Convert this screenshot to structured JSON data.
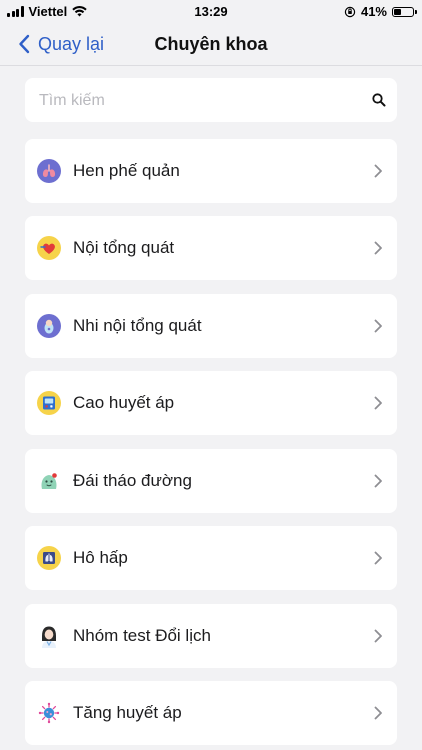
{
  "status_bar": {
    "carrier": "Viettel",
    "time": "13:29",
    "battery": "41%",
    "battery_level": 0.41
  },
  "nav": {
    "back_label": "Quay lại",
    "title": "Chuyên khoa"
  },
  "search": {
    "placeholder": "Tìm kiếm",
    "value": ""
  },
  "specialties": [
    {
      "label": "Hen phế quản",
      "icon": "lungs-icon"
    },
    {
      "label": "Nội tổng quát",
      "icon": "heart-icon"
    },
    {
      "label": "Nhi nội tổng quát",
      "icon": "baby-icon"
    },
    {
      "label": "Cao huyết áp",
      "icon": "blood-pressure-icon"
    },
    {
      "label": "Đái tháo đường",
      "icon": "diabetes-icon"
    },
    {
      "label": "Hô hấp",
      "icon": "xray-icon"
    },
    {
      "label": "Nhóm test Đổi lịch",
      "icon": "doctor-avatar-icon"
    },
    {
      "label": "Tăng huyết áp",
      "icon": "virus-icon"
    }
  ],
  "colors": {
    "accent": "#2f5fc8",
    "background": "#f2f2f4",
    "card": "#ffffff",
    "chevron": "#8e8e93"
  }
}
